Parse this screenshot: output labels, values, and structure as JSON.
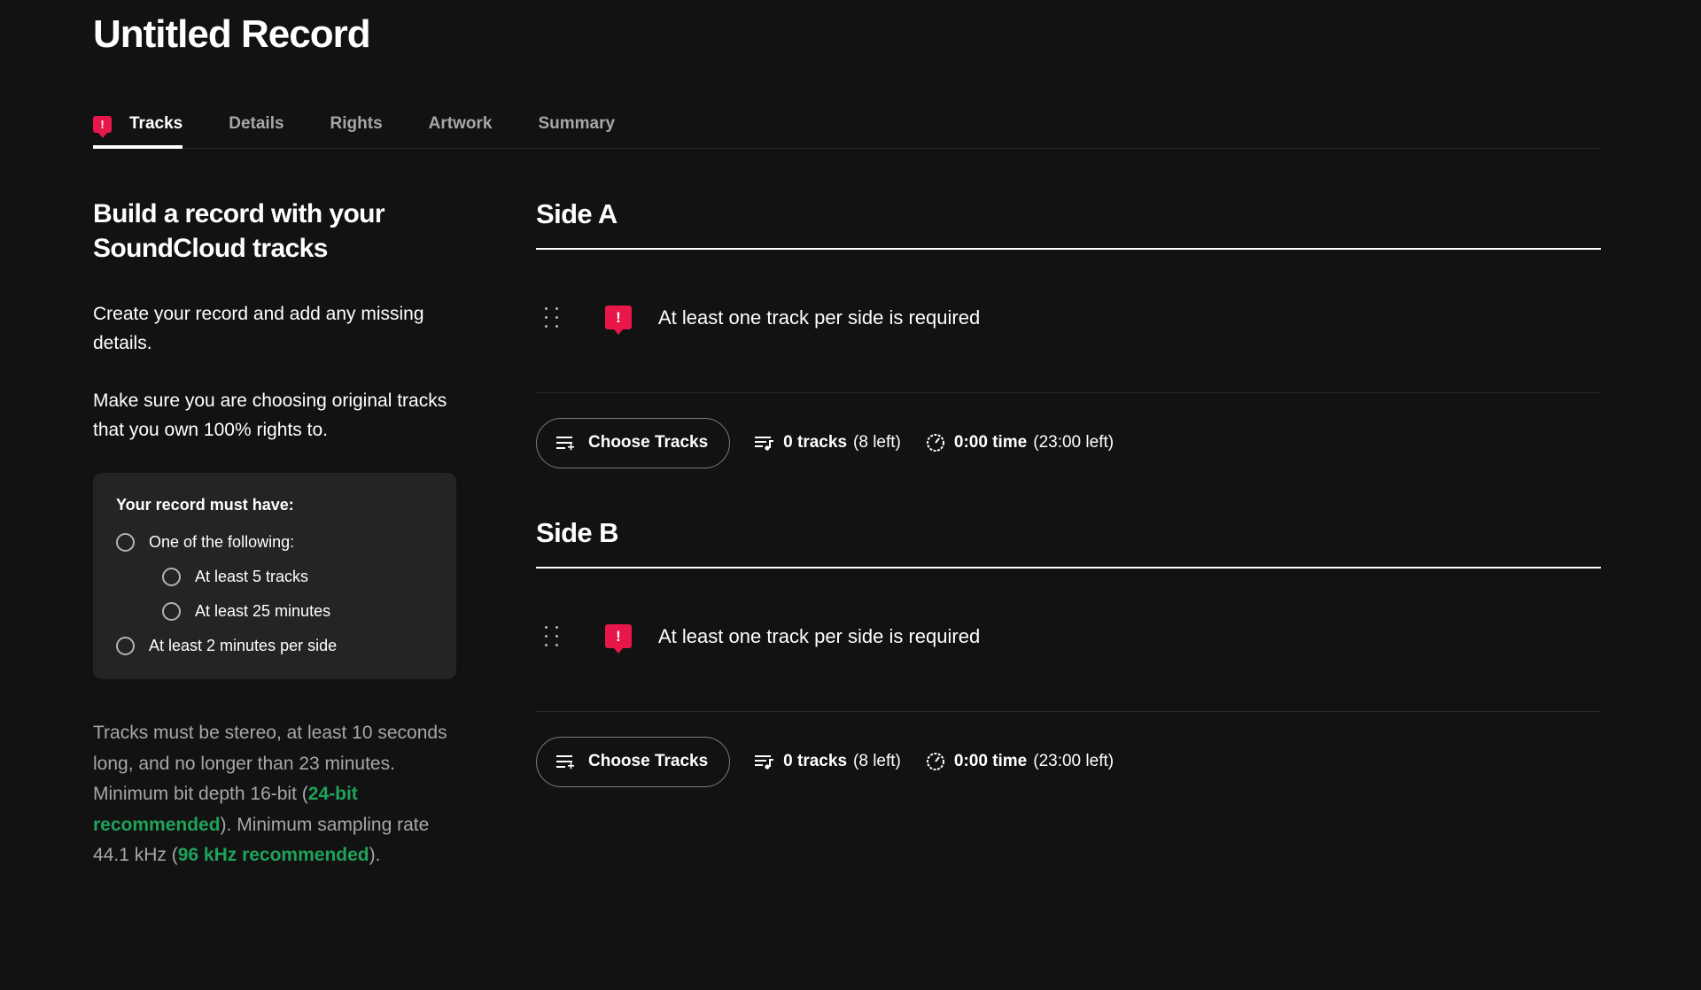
{
  "page": {
    "title": "Untitled Record"
  },
  "tabs": [
    {
      "label": "Tracks",
      "active": true,
      "warning": true
    },
    {
      "label": "Details"
    },
    {
      "label": "Rights"
    },
    {
      "label": "Artwork"
    },
    {
      "label": "Summary"
    }
  ],
  "intro": {
    "heading": "Build a record with your SoundCloud tracks",
    "p1": "Create your record and add any missing details.",
    "p2": "Make sure you are choosing original tracks that you own 100% rights to."
  },
  "requirements": {
    "title": "Your record must have:",
    "items": [
      {
        "label": "One of the following:"
      },
      {
        "label": "At least 5 tracks"
      },
      {
        "label": "At least 25 minutes"
      },
      {
        "label": "At least 2 minutes per side"
      }
    ]
  },
  "specs": {
    "part1": "Tracks must be stereo, at least 10 seconds long, and no longer than 23 minutes. Minimum bit depth 16-bit (",
    "hl1": "24-bit recommended",
    "part2": "). Minimum sampling rate 44.1 kHz (",
    "hl2": "96 kHz recommended",
    "part3": ")."
  },
  "sides": {
    "a": {
      "title": "Side A",
      "empty_message": "At least one track per side is required",
      "choose_label": "Choose Tracks",
      "tracks_value": "0 tracks",
      "tracks_left": "(8 left)",
      "time_value": "0:00 time",
      "time_left": "(23:00 left)"
    },
    "b": {
      "title": "Side B",
      "empty_message": "At least one track per side is required",
      "choose_label": "Choose Tracks",
      "tracks_value": "0 tracks",
      "tracks_left": "(8 left)",
      "time_value": "0:00 time",
      "time_left": "(23:00 left)"
    }
  },
  "icons": {
    "warning": "!"
  },
  "colors": {
    "background": "#121212",
    "warning": "#e8174a",
    "highlight": "#1ea35a",
    "panel": "#242424"
  }
}
